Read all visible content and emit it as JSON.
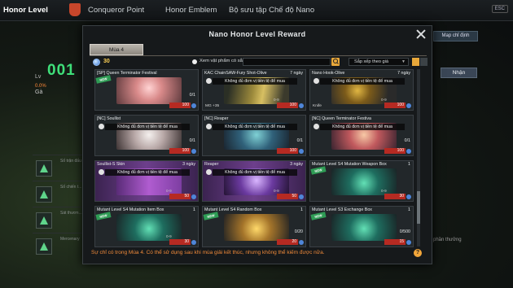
{
  "topbar": {
    "tabs": [
      {
        "label": "Honor Level"
      },
      {
        "label": "Conqueror Point"
      },
      {
        "label": "Honor Emblem"
      },
      {
        "label": "Bộ sưu tập Chế độ Nano"
      }
    ],
    "esc_label": "ESC"
  },
  "background": {
    "lv_label": "Lv",
    "level_value": "001",
    "percent": "0.0%",
    "rank_name": "Gà",
    "map_button": "Map chỉ định",
    "claim_button": "Nhận",
    "side_rows": [
      {
        "label": "Số trận đấu"
      },
      {
        "label": "Số chiến t..."
      },
      {
        "label": "Sát thươn..."
      },
      {
        "label": "Mercenary"
      }
    ],
    "reward_text": "n phần thưởng"
  },
  "modal": {
    "title": "Nano Honor Level Reward",
    "season_tab": "Mùa 4",
    "coin_value": "30",
    "owned_filter_label": "Xem vật phẩm có sẵn",
    "search_placeholder": "",
    "sort_label": "Sắp xếp theo giá",
    "lock_message": "Không đủ đơn vị tiền tệ để mua",
    "new_badge": "NEW",
    "footer_note": "Sự chỉ có trong Mùa 4. Có thể sử dụng sau khi mùa giải kết thúc, nhưng không thể kiếm được nữa.",
    "help_label": "?",
    "items": [
      {
        "title": "[SP] Queen Terminator Festival",
        "duration": "",
        "count": "0/1",
        "price": "100",
        "art": "art-pink",
        "locked": false,
        "new": true,
        "stars": "",
        "extra": ""
      },
      {
        "title": "KAC ChainSAW-Fury Shot-Olive",
        "duration": "7 ngày",
        "count": "",
        "price": "100",
        "art": "art-gold",
        "locked": true,
        "new": false,
        "stars": "0-9",
        "extra": "MG +35"
      },
      {
        "title": "Nano Hook-Olive",
        "duration": "7 ngày",
        "count": "",
        "price": "100",
        "art": "art-scythe",
        "locked": true,
        "new": false,
        "stars": "0-9",
        "extra": "Knife"
      },
      {
        "title": "[NC] Soullist",
        "duration": "",
        "count": "0/1",
        "price": "100",
        "art": "art-white",
        "locked": true,
        "new": false,
        "stars": "",
        "extra": ""
      },
      {
        "title": "[NC] Reaper",
        "duration": "",
        "count": "0/1",
        "price": "100",
        "art": "art-teal",
        "locked": true,
        "new": false,
        "stars": "",
        "extra": ""
      },
      {
        "title": "[NC] Queen Terminator Festiva",
        "duration": "",
        "count": "0/1",
        "price": "100",
        "art": "art-multi",
        "locked": true,
        "new": false,
        "stars": "",
        "extra": ""
      },
      {
        "title": "Soullist-S Skin",
        "duration": "3 ngày",
        "count": "",
        "price": "50",
        "art": "art-purple",
        "locked": true,
        "new": false,
        "stars": "0-9",
        "extra": ""
      },
      {
        "title": "Reaper",
        "duration": "3 ngày",
        "count": "",
        "price": "50",
        "art": "art-violet",
        "locked": true,
        "new": false,
        "stars": "0-9",
        "extra": ""
      },
      {
        "title": "Mutant Level S4 Mutation Weapon Box",
        "duration": "1",
        "count": "",
        "price": "30",
        "art": "art-box-g",
        "locked": false,
        "new": true,
        "stars": "0-9",
        "extra": ""
      },
      {
        "title": "Mutant Level S4 Mutation Item Box",
        "duration": "1",
        "count": "",
        "price": "30",
        "art": "art-box-g",
        "locked": false,
        "new": true,
        "stars": "0-9",
        "extra": ""
      },
      {
        "title": "Mutant Level S4 Random Box",
        "duration": "1",
        "count": "0/20",
        "price": "20",
        "art": "art-box-y",
        "locked": false,
        "new": true,
        "stars": "",
        "extra": ""
      },
      {
        "title": "Mutant Level S3 Exchange Box",
        "duration": "1",
        "count": "0/500",
        "price": "15",
        "art": "art-box-g",
        "locked": false,
        "new": true,
        "stars": "",
        "extra": ""
      }
    ]
  },
  "colors": {
    "accent_green": "#3fe07a",
    "price_red": "#b62a22",
    "note_orange": "#f08a3a",
    "coin_yellow": "#ffd257"
  }
}
